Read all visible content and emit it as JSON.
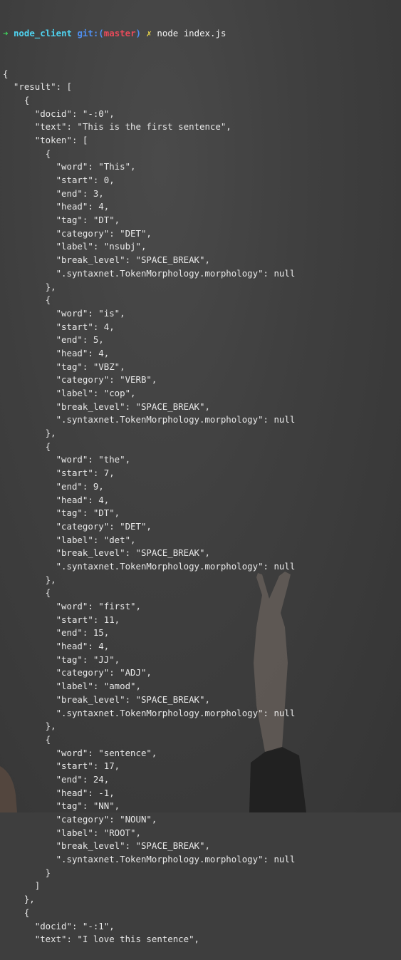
{
  "prompt": {
    "arrow": "➜",
    "directory": "node_client",
    "git_label": "git:(",
    "branch": "master",
    "git_close": ")",
    "dirty_mark": "✗",
    "command": "node index.js"
  },
  "output_lines": [
    "{",
    "  \"result\": [",
    "    {",
    "      \"docid\": \"-:0\",",
    "      \"text\": \"This is the first sentence\",",
    "      \"token\": [",
    "        {",
    "          \"word\": \"This\",",
    "          \"start\": 0,",
    "          \"end\": 3,",
    "          \"head\": 4,",
    "          \"tag\": \"DT\",",
    "          \"category\": \"DET\",",
    "          \"label\": \"nsubj\",",
    "          \"break_level\": \"SPACE_BREAK\",",
    "          \".syntaxnet.TokenMorphology.morphology\": null",
    "        },",
    "        {",
    "          \"word\": \"is\",",
    "          \"start\": 4,",
    "          \"end\": 5,",
    "          \"head\": 4,",
    "          \"tag\": \"VBZ\",",
    "          \"category\": \"VERB\",",
    "          \"label\": \"cop\",",
    "          \"break_level\": \"SPACE_BREAK\",",
    "          \".syntaxnet.TokenMorphology.morphology\": null",
    "        },",
    "        {",
    "          \"word\": \"the\",",
    "          \"start\": 7,",
    "          \"end\": 9,",
    "          \"head\": 4,",
    "          \"tag\": \"DT\",",
    "          \"category\": \"DET\",",
    "          \"label\": \"det\",",
    "          \"break_level\": \"SPACE_BREAK\",",
    "          \".syntaxnet.TokenMorphology.morphology\": null",
    "        },",
    "        {",
    "          \"word\": \"first\",",
    "          \"start\": 11,",
    "          \"end\": 15,",
    "          \"head\": 4,",
    "          \"tag\": \"JJ\",",
    "          \"category\": \"ADJ\",",
    "          \"label\": \"amod\",",
    "          \"break_level\": \"SPACE_BREAK\",",
    "          \".syntaxnet.TokenMorphology.morphology\": null",
    "        },",
    "        {",
    "          \"word\": \"sentence\",",
    "          \"start\": 17,",
    "          \"end\": 24,",
    "          \"head\": -1,",
    "          \"tag\": \"NN\",",
    "          \"category\": \"NOUN\",",
    "          \"label\": \"ROOT\",",
    "          \"break_level\": \"SPACE_BREAK\",",
    "          \".syntaxnet.TokenMorphology.morphology\": null",
    "        }",
    "      ]",
    "    },",
    "    {",
    "      \"docid\": \"-:1\",",
    "      \"text\": \"I love this sentence\","
  ]
}
